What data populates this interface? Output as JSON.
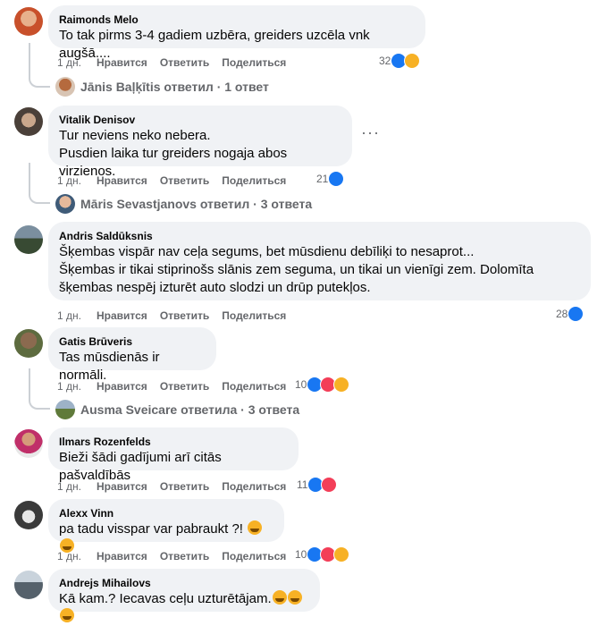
{
  "labels": {
    "like": "Нравится",
    "reply": "Ответить",
    "share": "Поделиться"
  },
  "comments": [
    {
      "author": "Raimonds Melo",
      "text": "To tak pirms 3-4 gadiem uzbēra, greiders uzcēla vnk augšā....",
      "time": "1 дн.",
      "reactions": "32"
    },
    {
      "author": "Vitalik Denisov",
      "text": "Tur neviens neko nebera.\nPusdien laika tur greiders nogaja abos virzienos.",
      "time": "1 дн.",
      "reactions": "21"
    },
    {
      "author": "Andris Saldūksnis",
      "text": "Šķembas vispār nav ceļa segums, bet mūsdienu debīliķi to nesaprot...\nŠķembas ir tikai stiprinošs slānis zem seguma, un tikai un vienīgi zem. Dolomīta šķembas nespēj izturēt auto slodzi un drūp putekļos.",
      "time": "1 дн.",
      "reactions": "28"
    },
    {
      "author": "Gatis Brūveris",
      "text": "Tas mūsdienās ir normāli.",
      "time": "1 дн.",
      "reactions": "10"
    },
    {
      "author": "Ilmars Rozenfelds",
      "text": "Bieži šādi gadījumi arī citās pašvaldībās",
      "time": "1 дн.",
      "reactions": "11"
    },
    {
      "author": "Alexx Vinn",
      "text": "pa tadu visspar var pabraukt ?! ",
      "time": "1 дн.",
      "reactions": "10"
    },
    {
      "author": "Andrejs Mihailovs",
      "text": "Kā kam.? Iecavas ceļu uzturētājam.",
      "time": "",
      "reactions": ""
    }
  ],
  "replies": [
    {
      "text": "Jānis Baļķītis ответил · 1 ответ"
    },
    {
      "text": "Māris Sevastjanovs ответил · 3 ответа"
    },
    {
      "text": "Ausma Sveicare ответила · 3 ответа"
    }
  ],
  "more_icon": "···",
  "colors": {
    "like": "#1877f2",
    "love": "#f33e58",
    "haha": "#f7b125",
    "bubble": "#f0f2f5",
    "meta": "#65676b"
  }
}
